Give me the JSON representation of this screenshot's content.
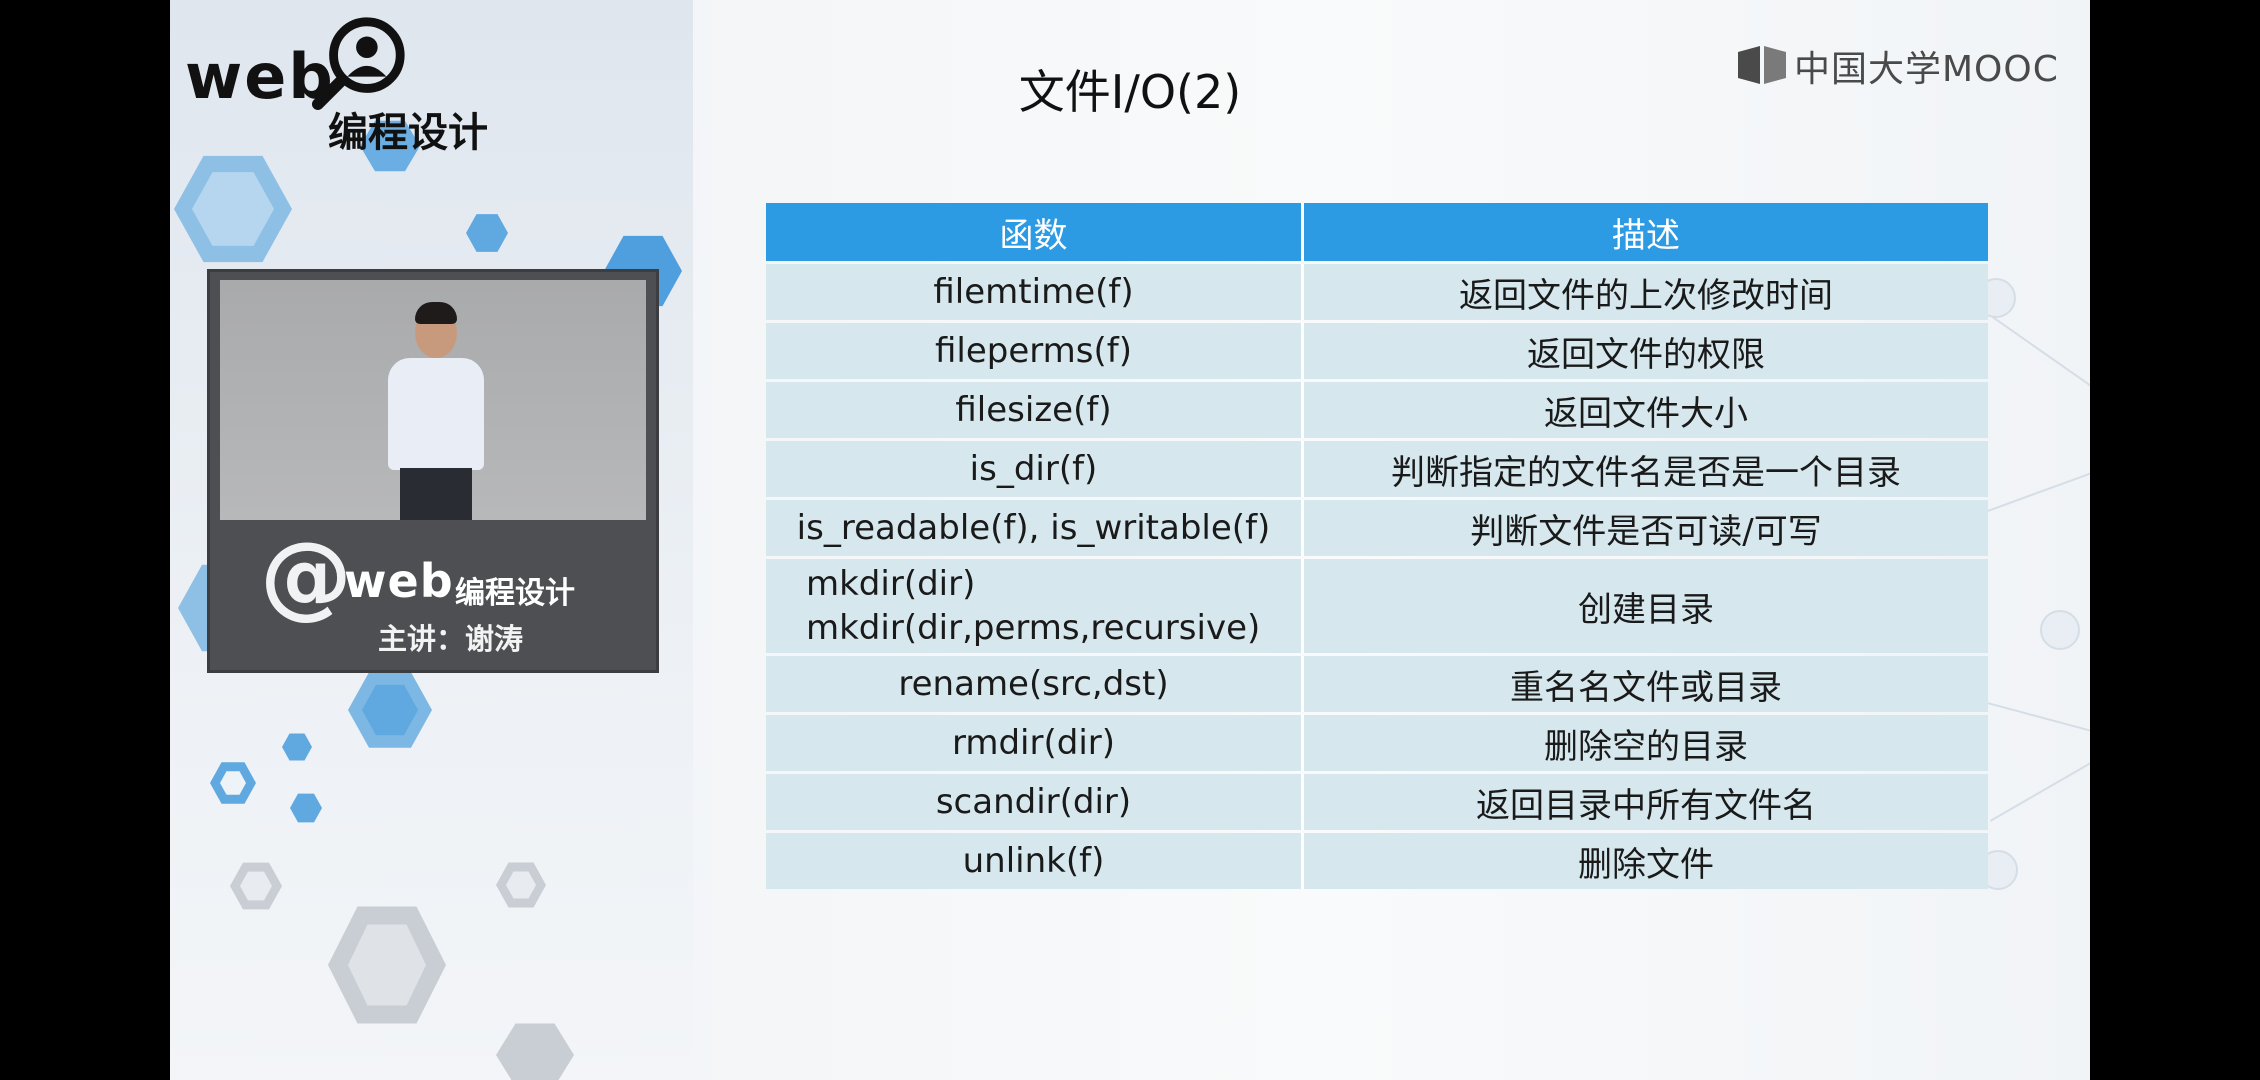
{
  "logo": {
    "web_text": "web",
    "cn_text": "编程设计"
  },
  "slide": {
    "title": "文件I/O(2)"
  },
  "branding": {
    "mooc_text": "中国大学MOOC"
  },
  "video": {
    "at_sign": "@",
    "web_text": "web",
    "cn_text": "编程设计",
    "lecturer": "主讲：谢涛"
  },
  "table": {
    "headers": [
      "函数",
      "描述"
    ],
    "rows": [
      {
        "func": "filemtime(f)",
        "desc": "返回文件的上次修改时间"
      },
      {
        "func": "fileperms(f)",
        "desc": "返回文件的权限"
      },
      {
        "func": "filesize(f)",
        "desc": "返回文件大小"
      },
      {
        "func": "is_dir(f)",
        "desc": "判断指定的文件名是否是一个目录"
      },
      {
        "func": "is_readable(f), is_writable(f)",
        "desc": "判断文件是否可读/可写"
      },
      {
        "func_lines": [
          "mkdir(dir)",
          "mkdir(dir,perms,recursive)"
        ],
        "desc": "创建目录"
      },
      {
        "func": "rename(src,dst)",
        "desc": "重名名文件或目录"
      },
      {
        "func": "rmdir(dir)",
        "desc": "删除空的目录"
      },
      {
        "func": "scandir(dir)",
        "desc": "返回目录中所有文件名"
      },
      {
        "func": "unlink(f)",
        "desc": "删除文件"
      }
    ]
  },
  "colors": {
    "header_bg": "#2d9be4",
    "row_bg": "#d6e8ee",
    "hex_blue": "#5fa8e0"
  }
}
